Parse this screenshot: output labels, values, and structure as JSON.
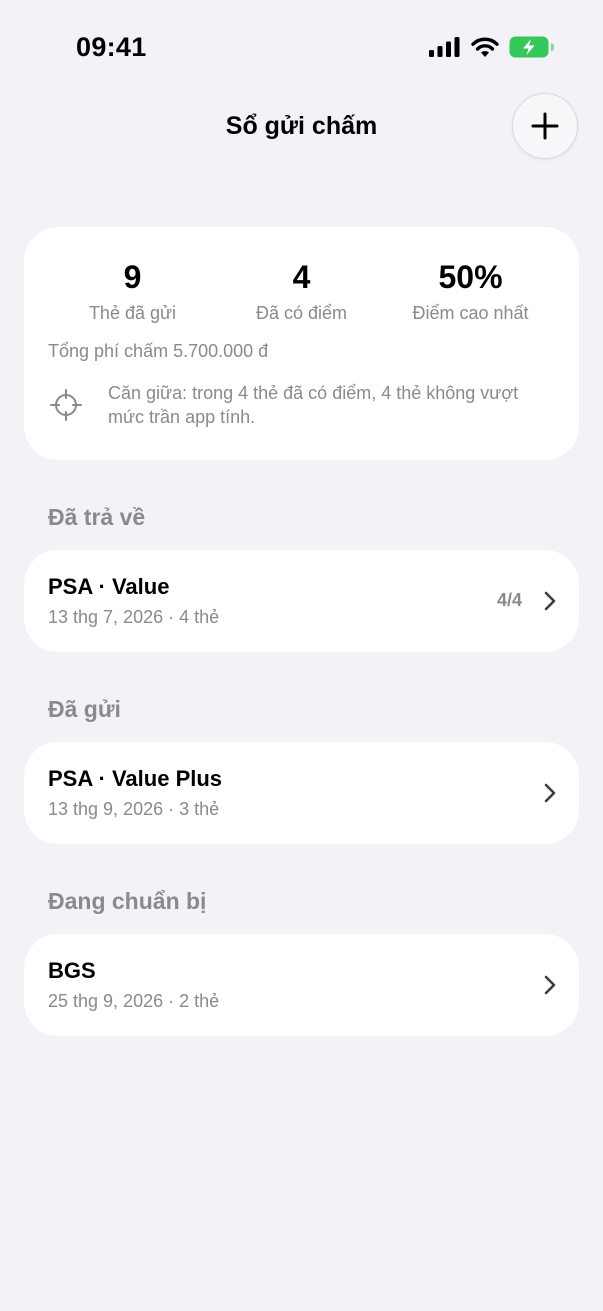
{
  "status_bar": {
    "time": "09:41"
  },
  "header": {
    "title": "Sổ gửi chấm",
    "add_icon": "plus-icon"
  },
  "summary": {
    "stats": [
      {
        "value": "9",
        "label": "Thẻ đã gửi"
      },
      {
        "value": "4",
        "label": "Đã có điểm"
      },
      {
        "value": "50%",
        "label": "Điểm cao nhất"
      }
    ],
    "fee": "Tổng phí chấm 5.700.000 đ",
    "note_icon": "crosshair-icon",
    "note": "Căn giữa: trong 4 thẻ đã có điểm, 4 thẻ không vượt mức trần app tính."
  },
  "sections": [
    {
      "title": "Đã trả về",
      "items": [
        {
          "title": "PSA · Value",
          "subtitle": "13 thg 7, 2026 · 4 thẻ",
          "count": "4/4"
        }
      ]
    },
    {
      "title": "Đã gửi",
      "items": [
        {
          "title": "PSA · Value Plus",
          "subtitle": "13 thg 9, 2026 · 3 thẻ"
        }
      ]
    },
    {
      "title": "Đang chuẩn bị",
      "items": [
        {
          "title": "BGS",
          "subtitle": "25 thg 9, 2026 · 2 thẻ"
        }
      ]
    }
  ],
  "colors": {
    "background": "#F2F2F7",
    "card": "#FFFFFF",
    "secondary_text": "#8A8A8E",
    "battery": "#34C759"
  }
}
